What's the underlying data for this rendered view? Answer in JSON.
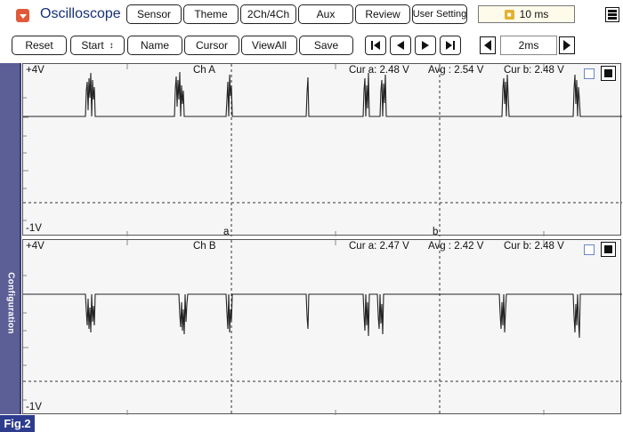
{
  "app": {
    "title": "Oscilloscope",
    "menu_icon": "dropdown-arrow-icon"
  },
  "top_tabs": [
    "Sensor",
    "Theme",
    "2Ch/4Ch",
    "Aux",
    "Review",
    "User Setting"
  ],
  "timebase": {
    "icon": "lock-icon",
    "value": "10 ms"
  },
  "toolbar": {
    "reset": "Reset",
    "start": "Start",
    "start_arrows": "↕",
    "name": "Name",
    "cursor": "Cursor",
    "viewall": "ViewAll",
    "save": "Save"
  },
  "playback_icons": [
    "skip-to-start-icon",
    "step-back-icon",
    "step-forward-icon",
    "skip-to-end-icon"
  ],
  "zoom": {
    "value": "2ms"
  },
  "side_tab": {
    "label": "Configuration"
  },
  "channels": [
    {
      "name": "Ch A",
      "top_label": "+4V",
      "bottom_label": "-1V",
      "cur_a": "Cur a: 2.48 V",
      "avg": "Avg : 2.54 V",
      "cur_b": "Cur b: 2.48 V",
      "cursor_a_marker": "a",
      "cursor_b_marker": "b"
    },
    {
      "name": "Ch B",
      "top_label": "+4V",
      "bottom_label": "-1V",
      "cur_a": "Cur a: 2.47 V",
      "avg": "Avg : 2.42 V",
      "cur_b": "Cur b: 2.48 V"
    }
  ],
  "figure_tag": "Fig.2",
  "colors": {
    "title": "#17307a",
    "side_tab": "#5c5f96",
    "figure_tag": "#2e3c8e",
    "menu_icon": "#e05a3a",
    "timebase_bg": "#fffbea"
  }
}
